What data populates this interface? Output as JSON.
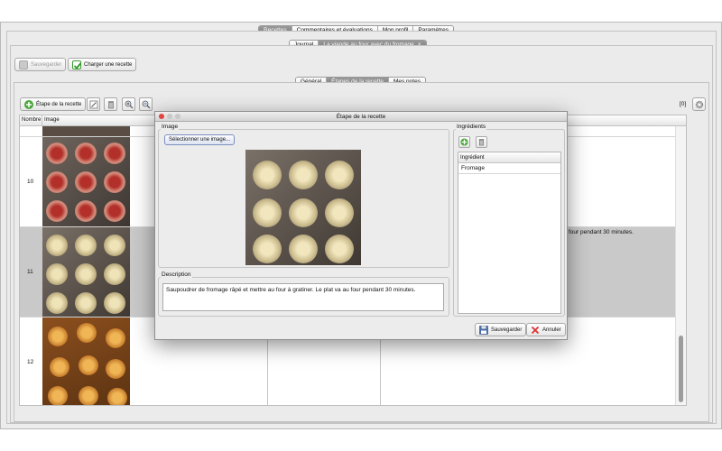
{
  "top_tabs": [
    "Recettes",
    "Commentaires et évaluations",
    "Mon profil",
    "Paramètres"
  ],
  "doc_tabs": {
    "journal": "Journal",
    "recipe": "La viande au four avec du fromage",
    "close": "×"
  },
  "toolbar": {
    "save": "Sauvegarder",
    "load": "Charger une recette"
  },
  "sub_tabs": [
    "Général",
    "Étapes de la recette",
    "Mes notes"
  ],
  "steps_toolbar": {
    "add_step": "Étape de la recette",
    "count": "[0]"
  },
  "table": {
    "headers": [
      "Nombre",
      "Image"
    ],
    "rows": [
      {
        "number": "10",
        "text": ""
      },
      {
        "number": "11",
        "text": "four pendant 30 minutes."
      },
      {
        "number": "12",
        "text": ""
      }
    ]
  },
  "dialog": {
    "title": "Étape de la recette",
    "image_label": "Image",
    "select_image": "Sélectionner une image...",
    "description_label": "Description",
    "description": "Saupoudrer de fromage râpé et mettre au four à gratiner. Le plat va au four pendant 30 minutes.",
    "ingredients_label": "Ingrédients",
    "ingredients_header": "Ingrédient",
    "ingredients": [
      "Fromage"
    ],
    "save": "Sauvegarder",
    "cancel": "Annuler"
  },
  "colors": {
    "selected_tab": "#868686",
    "selected_row": "#c9c9c9",
    "add_green": "#4aa83a",
    "cancel_red": "#d33"
  }
}
